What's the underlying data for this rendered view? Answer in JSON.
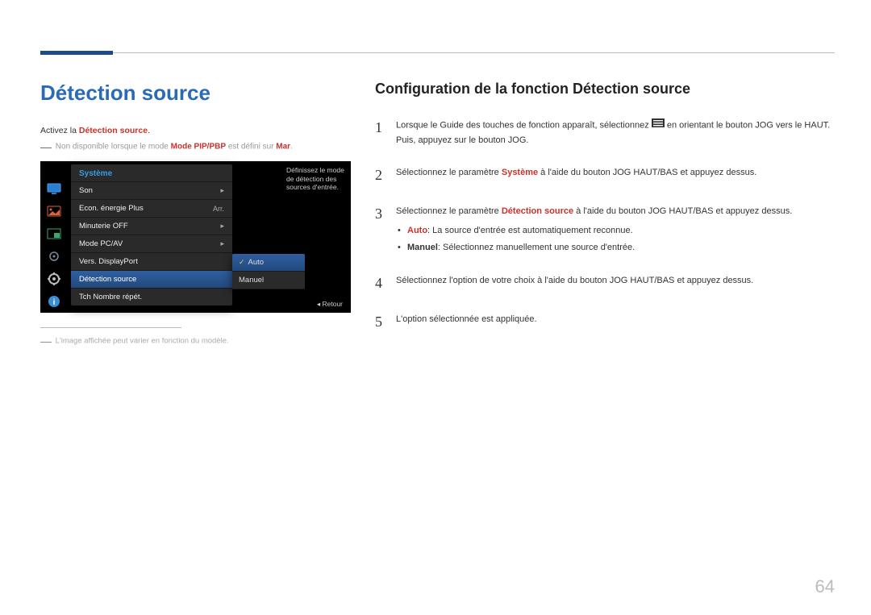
{
  "page_number": "64",
  "page_title": "Détection source",
  "section_title": "Configuration de la fonction Détection source",
  "left": {
    "activez_pre": "Activez la ",
    "activez_bold": "Détection source",
    "activez_post": ".",
    "note_pre": "Non disponible lorsque le mode ",
    "note_bold": "Mode PIP/PBP",
    "note_mid": " est défini sur ",
    "note_bold2": "Mar",
    "note_post": ".",
    "footnote": "L'image affichée peut varier en fonction du modèle."
  },
  "osd": {
    "header": "Système",
    "info": "Définissez le mode de détection des sources d'entrée.",
    "return": "Retour",
    "rows": [
      {
        "label": "Son",
        "value": "",
        "arrow": true,
        "selected": false
      },
      {
        "label": "Econ. énergie Plus",
        "value": "Arr.",
        "arrow": false,
        "selected": false
      },
      {
        "label": "Minuterie OFF",
        "value": "",
        "arrow": true,
        "selected": false
      },
      {
        "label": "Mode PC/AV",
        "value": "",
        "arrow": true,
        "selected": false
      },
      {
        "label": "Vers. DisplayPort",
        "value": "",
        "arrow": false,
        "selected": false
      },
      {
        "label": "Détection source",
        "value": "",
        "arrow": false,
        "selected": true
      },
      {
        "label": "Tch Nombre répét.",
        "value": "",
        "arrow": false,
        "selected": false
      }
    ],
    "submenu": [
      {
        "label": "Auto",
        "selected": true
      },
      {
        "label": "Manuel",
        "selected": false
      }
    ]
  },
  "steps": [
    {
      "num": "1",
      "pre": "Lorsque le Guide des touches de fonction apparaît, sélectionnez ",
      "icon": true,
      "post": " en orientant le bouton JOG vers le HAUT. Puis, appuyez sur le bouton JOG."
    },
    {
      "num": "2",
      "pre": "Sélectionnez le paramètre ",
      "bold": "Système",
      "post": " à l'aide du bouton JOG HAUT/BAS et appuyez dessus."
    },
    {
      "num": "3",
      "pre": "Sélectionnez le paramètre ",
      "bold": "Détection source",
      "post": " à l'aide du bouton JOG HAUT/BAS et appuyez dessus.",
      "bullets": [
        {
          "bold": "Auto",
          "text": ": La source d'entrée est automatiquement reconnue."
        },
        {
          "bold": "Manuel",
          "text": ": Sélectionnez manuellement une source d'entrée.",
          "plain_bold": true
        }
      ]
    },
    {
      "num": "4",
      "pre": "Sélectionnez l'option de votre choix à l'aide du bouton JOG HAUT/BAS et appuyez dessus."
    },
    {
      "num": "5",
      "pre": "L'option sélectionnée est appliquée."
    }
  ]
}
